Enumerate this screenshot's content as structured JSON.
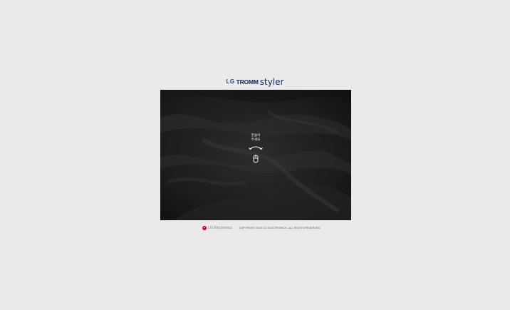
{
  "brand": {
    "lg": "LG",
    "tromm": "TROMM",
    "styler": "styler"
  },
  "hero": {
    "hint_text": "흔들어\n주세요",
    "arrow_icon": "swipe-arrow-icon",
    "mouse_icon": "mouse-icon"
  },
  "footer": {
    "company_logo_text": "LG Electronics",
    "copyright": "COPYRIGHT 2019 LG ELECTRONICS. ALL RIGHTS RESERVED.",
    "logo_color": "#c70a4c"
  },
  "colors": {
    "background": "#eaeaea",
    "brand_navy": "#13265e",
    "fabric_dark": "#1a1a1a"
  }
}
